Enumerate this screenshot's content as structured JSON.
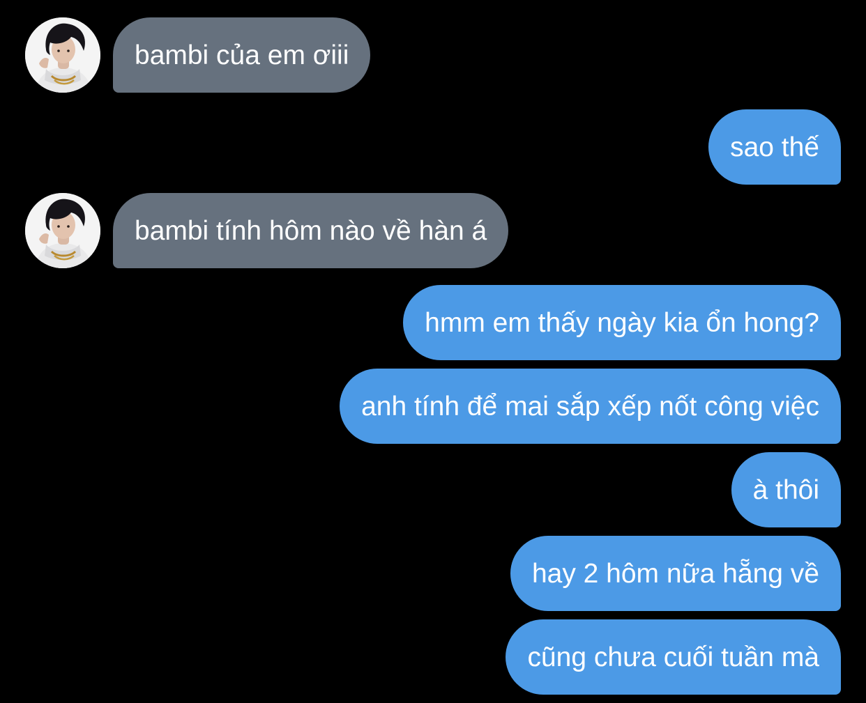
{
  "thread": {
    "messages": [
      {
        "direction": "incoming",
        "text": "bambi của em ơiii"
      },
      {
        "direction": "outgoing",
        "text": "sao thế"
      },
      {
        "direction": "incoming",
        "text": "bambi tính hôm nào về hàn á"
      },
      {
        "direction": "outgoing",
        "text": "hmm em thấy ngày kia ổn hong?"
      },
      {
        "direction": "outgoing",
        "text": "anh tính để mai sắp xếp nốt công việc"
      },
      {
        "direction": "outgoing",
        "text": "à thôi"
      },
      {
        "direction": "outgoing",
        "text": "hay 2 hôm nữa hẵng về"
      },
      {
        "direction": "outgoing",
        "text": "cũng chưa cuối tuần mà"
      }
    ]
  },
  "colors": {
    "background": "#000000",
    "incoming_bubble": "#66717e",
    "outgoing_bubble": "#4c9ae6",
    "text": "#ffffff"
  },
  "icons": {
    "contact_avatar": "avatar"
  }
}
